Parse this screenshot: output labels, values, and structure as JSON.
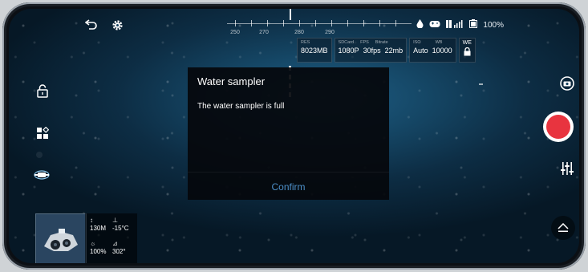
{
  "status": {
    "icons": [
      "water-drop-icon",
      "gamepad-icon",
      "signal-icon",
      "battery-icon"
    ],
    "battery_percent": "100%"
  },
  "compass": {
    "ticks": [
      "250",
      "270",
      "280",
      "290"
    ]
  },
  "params": {
    "storage": {
      "labels": [
        "RES",
        ""
      ],
      "values": [
        "8023MB",
        ""
      ]
    },
    "video": {
      "labels": [
        "SDCard",
        "FPS",
        "Bitrate"
      ],
      "values": [
        "1080P",
        "30fps",
        "22mb"
      ]
    },
    "exposure": {
      "labels": [
        "ISO",
        "WB"
      ],
      "values": [
        "Auto",
        "10000"
      ]
    },
    "lock": {
      "label": "WE"
    }
  },
  "dialog": {
    "title": "Water sampler",
    "message": "The water sampler is full",
    "confirm_label": "Confirm"
  },
  "telemetry": {
    "depth": "130M",
    "temperature": "-15°C",
    "light": "100%",
    "heading": "302°"
  },
  "colors": {
    "record": "#e8343f",
    "confirm": "#4c8ec7"
  }
}
